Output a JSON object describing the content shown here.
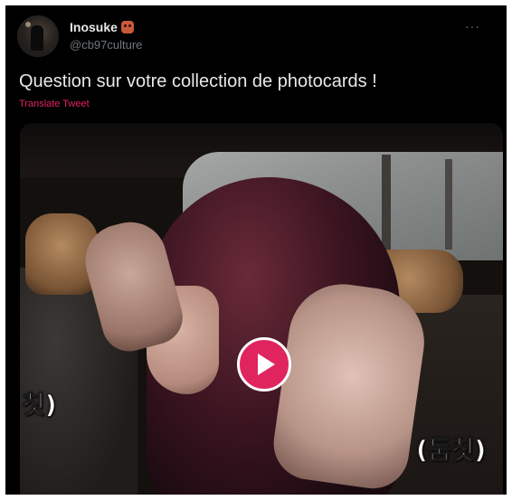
{
  "tweet": {
    "author": {
      "display_name": "Inosuke",
      "handle": "@cb97culture",
      "avatar_icon": "avatar-photo",
      "badge_icon": "boar-emoji-icon"
    },
    "more_label": "···",
    "text": "Question sur votre collection de photocards !",
    "translate_label": "Translate Tweet",
    "media": {
      "type": "video",
      "caption_left": "칫)",
      "caption_right": "(둠칫)",
      "play_icon": "play-icon"
    }
  },
  "colors": {
    "background": "#000000",
    "text": "#e7e9ea",
    "secondary": "#71767b",
    "accent": "#e0245e"
  }
}
